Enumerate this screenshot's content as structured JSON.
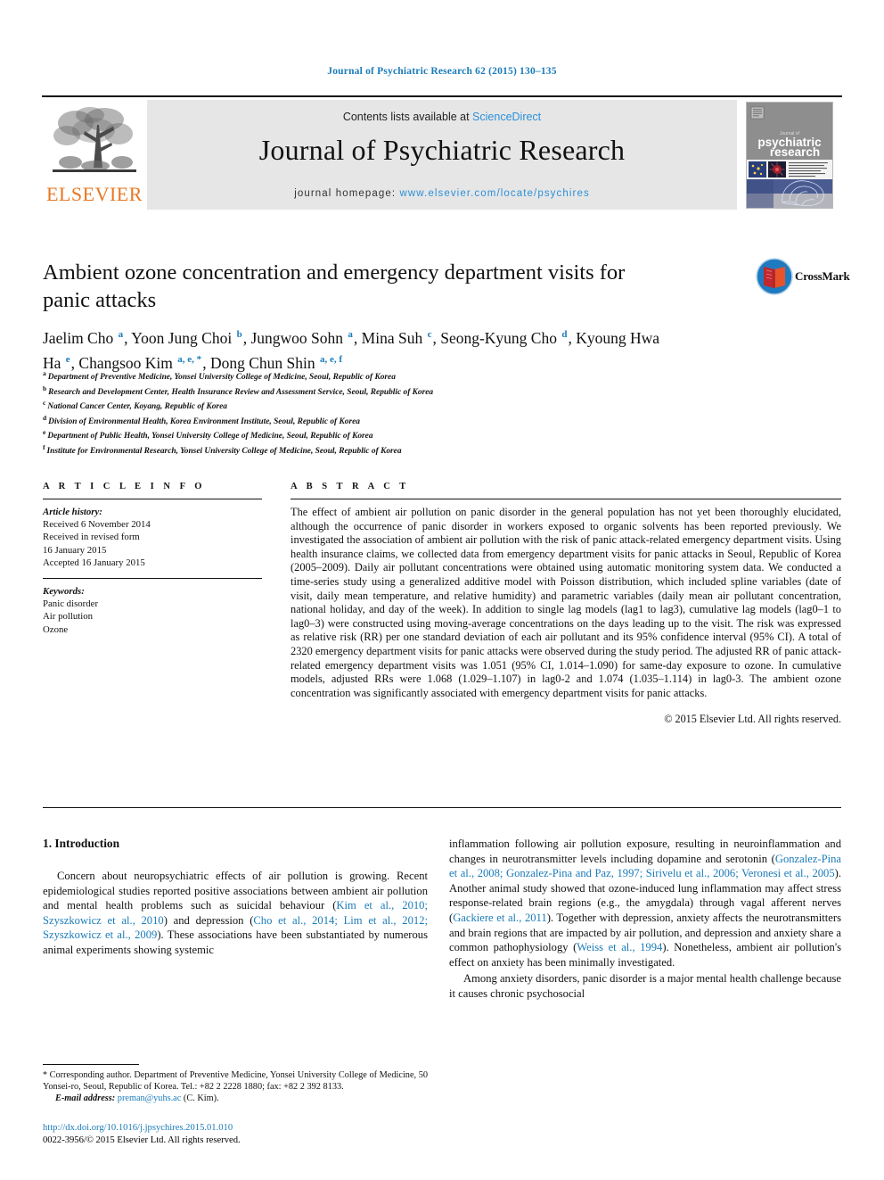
{
  "running_head": "Journal of Psychiatric Research 62 (2015) 130–135",
  "masthead": {
    "contents_prefix": "Contents lists available at ",
    "sciencedirect": "ScienceDirect",
    "journal_title": "Journal of Psychiatric Research",
    "homepage_prefix": "journal homepage: ",
    "homepage_url": "www.elsevier.com/locate/psychires",
    "publisher_wordmark": "ELSEVIER",
    "cover_title_line1": "psychiatric",
    "cover_title_line2": "research",
    "cover_title_small": "Journal of"
  },
  "article": {
    "title": "Ambient ozone concentration and emergency department visits for panic attacks",
    "crossmark_label": "CrossMark",
    "authors_html": "Jaelim Cho <sup>a</sup>, Yoon Jung Choi <sup>b</sup>, Jungwoo Sohn <sup>a</sup>, Mina Suh <sup>c</sup>, Seong-Kyung Cho <sup>d</sup>, Kyoung Hwa Ha <sup>e</sup>, Changsoo Kim <sup>a, e, *</sup>, Dong Chun Shin <sup>a, e, f</sup>",
    "affiliations": [
      {
        "mark": "a",
        "text": "Department of Preventive Medicine, Yonsei University College of Medicine, Seoul, Republic of Korea"
      },
      {
        "mark": "b",
        "text": "Research and Development Center, Health Insurance Review and Assessment Service, Seoul, Republic of Korea"
      },
      {
        "mark": "c",
        "text": "National Cancer Center, Koyang, Republic of Korea"
      },
      {
        "mark": "d",
        "text": "Division of Environmental Health, Korea Environment Institute, Seoul, Republic of Korea"
      },
      {
        "mark": "e",
        "text": "Department of Public Health, Yonsei University College of Medicine, Seoul, Republic of Korea"
      },
      {
        "mark": "f",
        "text": "Institute for Environmental Research, Yonsei University College of Medicine, Seoul, Republic of Korea"
      }
    ]
  },
  "article_info": {
    "heading": "A R T I C L E   I N F O",
    "history_label": "Article history:",
    "history": [
      "Received 6 November 2014",
      "Received in revised form",
      "16 January 2015",
      "Accepted 16 January 2015"
    ],
    "keywords_label": "Keywords:",
    "keywords": [
      "Panic disorder",
      "Air pollution",
      "Ozone"
    ]
  },
  "abstract": {
    "heading": "A B S T R A C T",
    "text": "The effect of ambient air pollution on panic disorder in the general population has not yet been thoroughly elucidated, although the occurrence of panic disorder in workers exposed to organic solvents has been reported previously. We investigated the association of ambient air pollution with the risk of panic attack-related emergency department visits. Using health insurance claims, we collected data from emergency department visits for panic attacks in Seoul, Republic of Korea (2005–2009). Daily air pollutant concentrations were obtained using automatic monitoring system data. We conducted a time-series study using a generalized additive model with Poisson distribution, which included spline variables (date of visit, daily mean temperature, and relative humidity) and parametric variables (daily mean air pollutant concentration, national holiday, and day of the week). In addition to single lag models (lag1 to lag3), cumulative lag models (lag0–1 to lag0–3) were constructed using moving-average concentrations on the days leading up to the visit. The risk was expressed as relative risk (RR) per one standard deviation of each air pollutant and its 95% confidence interval (95% CI). A total of 2320 emergency department visits for panic attacks were observed during the study period. The adjusted RR of panic attack-related emergency department visits was 1.051 (95% CI, 1.014–1.090) for same-day exposure to ozone. In cumulative models, adjusted RRs were 1.068 (1.029–1.107) in lag0-2 and 1.074 (1.035–1.114) in lag0-3. The ambient ozone concentration was significantly associated with emergency department visits for panic attacks.",
    "copyright": "© 2015 Elsevier Ltd. All rights reserved."
  },
  "introduction": {
    "heading": "1. Introduction",
    "left_p1_a": "Concern about neuropsychiatric effects of air pollution is growing. Recent epidemiological studies reported positive associations between ambient air pollution and mental health problems such as suicidal behaviour (",
    "left_cite1": "Kim et al., 2010; Szyszkowicz et al., 2010",
    "left_p1_b": ") and depression (",
    "left_cite2": "Cho et al., 2014; Lim et al., 2012; Szyszkowicz et al., 2009",
    "left_p1_c": "). These associations have been substantiated by numerous animal experiments showing systemic",
    "right_p1_a": "inflammation following air pollution exposure, resulting in neuroinflammation and changes in neurotransmitter levels including dopamine and serotonin (",
    "right_cite1": "Gonzalez-Pina et al., 2008; Gonzalez-Pina and Paz, 1997; Sirivelu et al., 2006; Veronesi et al., 2005",
    "right_p1_b": "). Another animal study showed that ozone-induced lung inflammation may affect stress response-related brain regions (e.g., the amygdala) through vagal afferent nerves (",
    "right_cite2": "Gackiere et al., 2011",
    "right_p1_c": "). Together with depression, anxiety affects the neurotransmitters and brain regions that are impacted by air pollution, and depression and anxiety share a common pathophysiology (",
    "right_cite3": "Weiss et al., 1994",
    "right_p1_d": "). Nonetheless, ambient air pollution's effect on anxiety has been minimally investigated.",
    "right_p2": "Among anxiety disorders, panic disorder is a major mental health challenge because it causes chronic psychosocial"
  },
  "footnotes": {
    "corresponding_star": "*",
    "corresponding_text": " Corresponding author. Department of Preventive Medicine, Yonsei University College of Medicine, 50 Yonsei-ro, Seoul, Republic of Korea. Tel.: +82 2 2228 1880; fax: +82 2 392 8133.",
    "email_label": "E-mail address:",
    "email": "preman@yuhs.ac",
    "email_suffix": " (C. Kim)."
  },
  "doi": {
    "url": "http://dx.doi.org/10.1016/j.jpsychires.2015.01.010",
    "issn_line": "0022-3956/© 2015 Elsevier Ltd. All rights reserved."
  },
  "colors": {
    "link_blue": "#1a7bb9",
    "sciencedirect_blue": "#2b90d9",
    "elsevier_orange": "#e87722",
    "masthead_gray": "#e6e6e6"
  }
}
